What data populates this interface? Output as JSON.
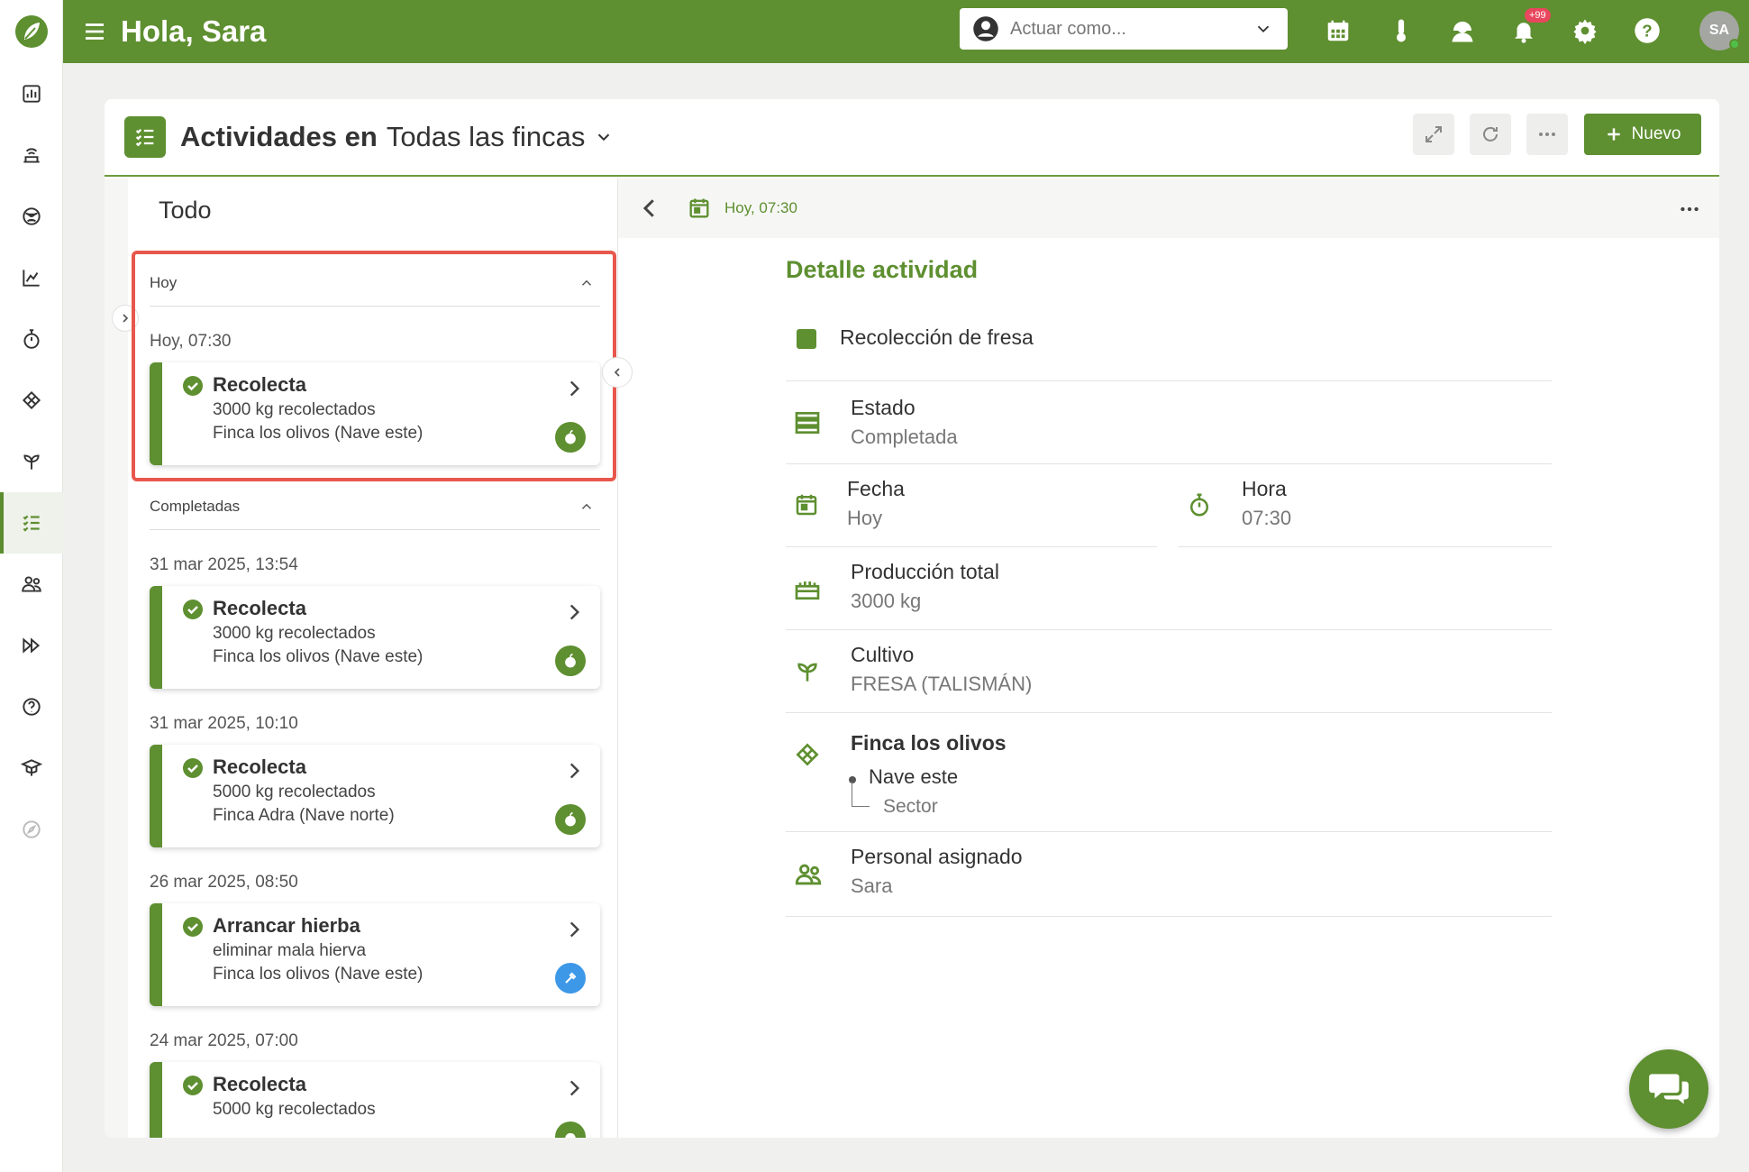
{
  "topbar": {
    "greeting": "Hola, Sara",
    "act_as_placeholder": "Actuar como...",
    "notifications_badge": "+99",
    "avatar_initials": "SA"
  },
  "header": {
    "title": "Actividades en",
    "farm_selector": "Todas las fincas",
    "new_button": "Nuevo"
  },
  "list": {
    "filter_title": "Todo",
    "sections": [
      {
        "label": "Hoy",
        "groups": [
          {
            "date": "Hoy, 07:30",
            "title": "Recolecta",
            "line1": "3000 kg recolectados",
            "line2": "Finca los olivos (Nave este)",
            "category": "harvest-icon"
          }
        ]
      },
      {
        "label": "Completadas",
        "groups": [
          {
            "date": "31 mar 2025, 13:54",
            "title": "Recolecta",
            "line1": "3000 kg recolectados",
            "line2": "Finca los olivos (Nave este)",
            "category": "harvest-icon"
          },
          {
            "date": "31 mar 2025, 10:10",
            "title": "Recolecta",
            "line1": "5000 kg recolectados",
            "line2": "Finca Adra (Nave norte)",
            "category": "harvest-icon"
          },
          {
            "date": "26 mar 2025, 08:50",
            "title": "Arrancar hierba",
            "line1": "eliminar mala hierva",
            "line2": "Finca los olivos (Nave este)",
            "category": "tool-icon"
          },
          {
            "date": "24 mar 2025, 07:00",
            "title": "Recolecta",
            "line1": "5000 kg recolectados",
            "line2": "",
            "category": "harvest-icon"
          }
        ]
      }
    ]
  },
  "detail": {
    "bar_date": "Hoy, 07:30",
    "heading": "Detalle actividad",
    "activity_name": "Recolección de fresa",
    "estado_label": "Estado",
    "estado_value": "Completada",
    "fecha_label": "Fecha",
    "fecha_value": "Hoy",
    "hora_label": "Hora",
    "hora_value": "07:30",
    "produccion_label": "Producción total",
    "produccion_value": "3000 kg",
    "cultivo_label": "Cultivo",
    "cultivo_value": "FRESA (TALISMÁN)",
    "finca_name": "Finca los olivos",
    "nave_name": "Nave este",
    "sector_label": "Sector",
    "personal_label": "Personal asignado",
    "personal_value": "Sara"
  },
  "colors": {
    "brand": "#5e8f30",
    "highlight": "#e8574d",
    "tool_badge": "#3d98e8"
  }
}
